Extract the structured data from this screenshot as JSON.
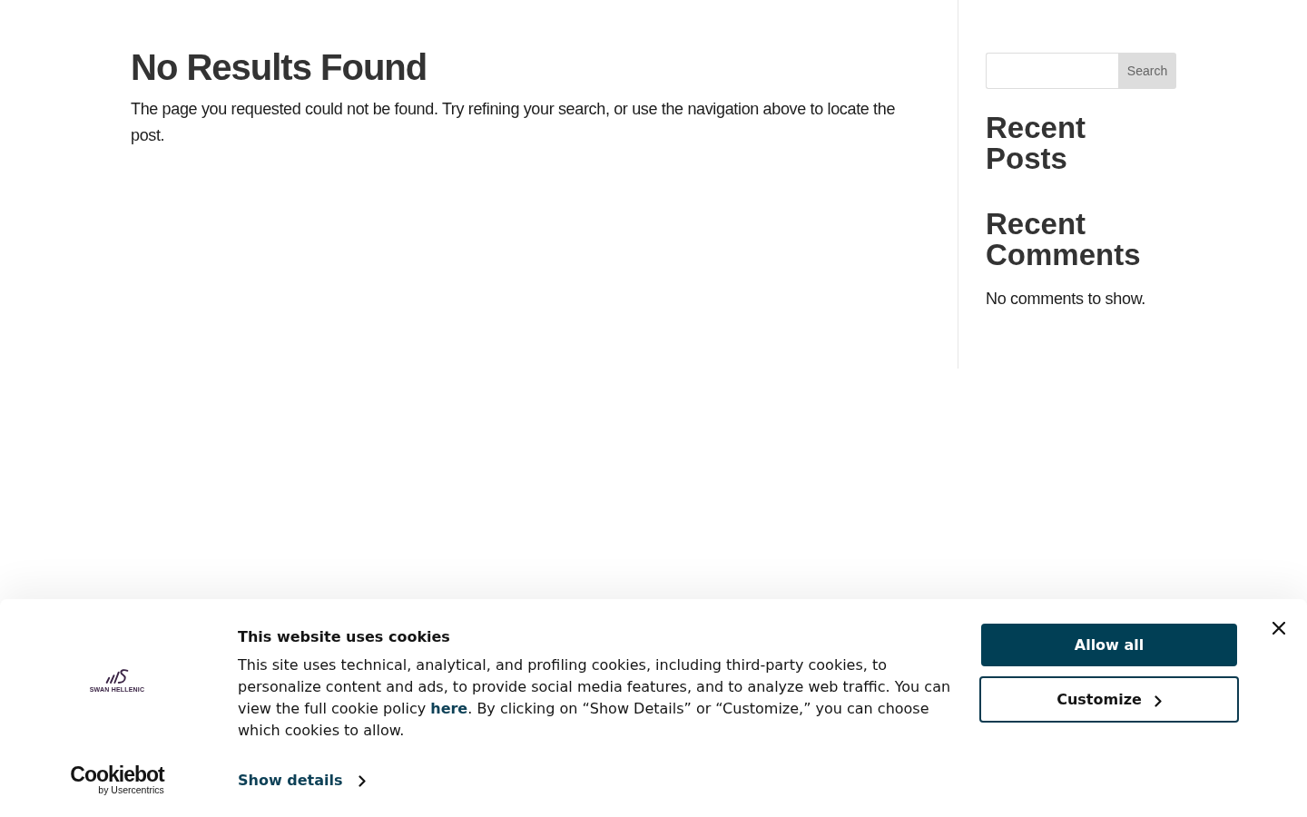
{
  "main": {
    "title": "No Results Found",
    "message": "The page you requested could not be found. Try refining your search, or use the navigation above to locate the post."
  },
  "sidebar": {
    "search": {
      "button": "Search"
    },
    "widgets": [
      {
        "title": "Recent Posts"
      },
      {
        "title": "Recent Comments",
        "text": "No comments to show."
      }
    ]
  },
  "cookie_banner": {
    "logo_text": "SWAN HELLENIC",
    "provider": {
      "name": "Cookiebot",
      "byline": "by Usercentrics"
    },
    "title": "This website uses cookies",
    "body": {
      "before": "This site uses technical, analytical, and profiling cookies, including third-party cookies, to personalize content and ads, to provide social media features, and to analyze web traffic. You can view the full cookie policy ",
      "link": "here",
      "after": ". By clicking on “Show Details” or “Customize,” you can choose which cookies to allow."
    },
    "details_link": "Show details",
    "buttons": [
      {
        "label": "Allow all",
        "kind": "primary"
      },
      {
        "label": "Customize",
        "kind": "secondary"
      }
    ]
  }
}
